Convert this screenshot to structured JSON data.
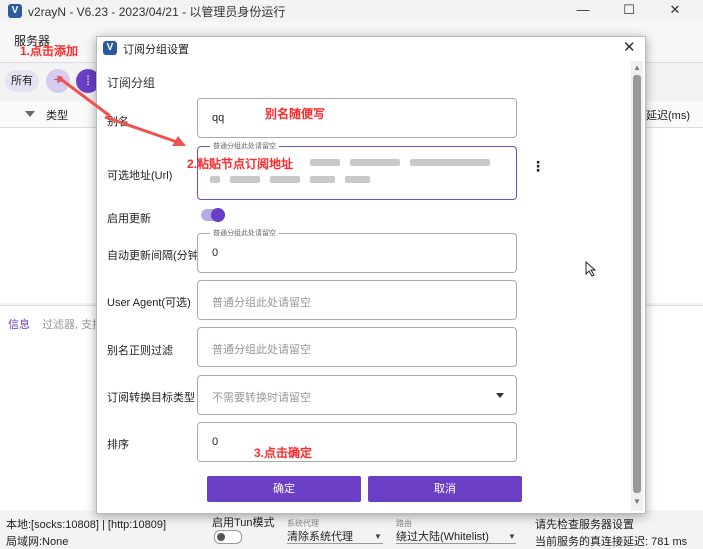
{
  "window": {
    "title": "v2rayN - V6.23 - 2023/04/21 - 以管理员身份运行",
    "minimize": "—",
    "maximize": "☐",
    "close": "✕"
  },
  "toolbar": {
    "servers_menu": "服务器",
    "all_button": "所有",
    "add_button": "+",
    "more_button": "⁞"
  },
  "table": {
    "col_type": "类型",
    "col_delay": "延迟(ms)"
  },
  "info": {
    "tab": "信息",
    "filter_placeholder": "过滤器, 支持"
  },
  "status_bar": {
    "local_ports": "本地:[socks:10808] | [http:10809]",
    "lan": "局域网:None",
    "tun_label": "启用Tun模式",
    "sysproxy_caption": "系统代理",
    "sysproxy_value": "清除系统代理",
    "routing_caption": "路由",
    "routing_value": "绕过大陆(Whitelist)",
    "check_msg": "请先检查服务器设置",
    "latency_msg": "当前服务的真连接延迟: 781 ms"
  },
  "dialog": {
    "title": "订阅分组设置",
    "close": "✕",
    "section": "订阅分组",
    "fields": {
      "alias": {
        "label": "别名",
        "value": "qq"
      },
      "url": {
        "label": "可选地址(Url)",
        "float_label": "普通分组此处请留空"
      },
      "enable_update": {
        "label": "启用更新",
        "on": true
      },
      "auto_interval": {
        "label": "自动更新间隔(分钟)",
        "float_label": "普通分组此处请留空",
        "value": "0"
      },
      "user_agent": {
        "label": "User Agent(可选)",
        "placeholder": "普通分组此处请留空"
      },
      "alias_filter": {
        "label": "别名正则过滤",
        "placeholder": "普通分组此处请留空"
      },
      "convert_target": {
        "label": "订阅转换目标类型",
        "placeholder": "不需要转换时请留空"
      },
      "sort": {
        "label": "排序",
        "value": "0"
      }
    },
    "ok_button": "确定",
    "cancel_button": "取消"
  },
  "annotations": {
    "step1": "1.点击添加",
    "step2": "2.粘贴节点订阅地址",
    "step3": "3.点击确定",
    "alias_hint": "别名随便写",
    "color": "#ff2a2a"
  },
  "colors": {
    "accent": "#6a3fc6",
    "annotation": "#ff2a2a"
  }
}
